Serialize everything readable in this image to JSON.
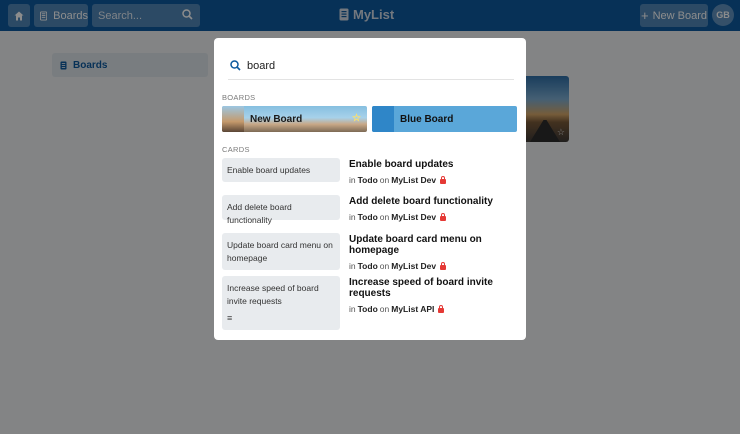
{
  "topbar": {
    "boards_label": "Boards",
    "search_placeholder": "Search...",
    "logo_text": "MyList",
    "new_board_label": "New Board",
    "avatar_initials": "GB"
  },
  "sidebar": {
    "items": [
      {
        "label": "Boards"
      }
    ]
  },
  "modal": {
    "search_value": "board",
    "boards_heading": "BOARDS",
    "boards": [
      {
        "name": "New Board",
        "starred": true
      },
      {
        "name": "Blue Board",
        "starred": false
      }
    ],
    "cards_heading": "CARDS",
    "cards": [
      {
        "title": "Enable board updates",
        "in_word": "in",
        "list": "Todo",
        "on_word": "on",
        "board": "MyList Dev"
      },
      {
        "title": "Add delete board functionality",
        "in_word": "in",
        "list": "Todo",
        "on_word": "on",
        "board": "MyList Dev"
      },
      {
        "title": "Update board card menu on homepage",
        "in_word": "in",
        "list": "Todo",
        "on_word": "on",
        "board": "MyList Dev"
      },
      {
        "title": "Increase speed of board invite requests",
        "in_word": "in",
        "list": "Todo",
        "on_word": "on",
        "board": "MyList API"
      }
    ]
  },
  "colors": {
    "header": "#0d5a9e",
    "accent_blue": "#5aa7d9",
    "lock": "#e53935"
  },
  "icons": [
    "home-icon",
    "board-icon",
    "search-icon",
    "plus-icon",
    "star-icon",
    "lock-icon",
    "description-icon"
  ]
}
